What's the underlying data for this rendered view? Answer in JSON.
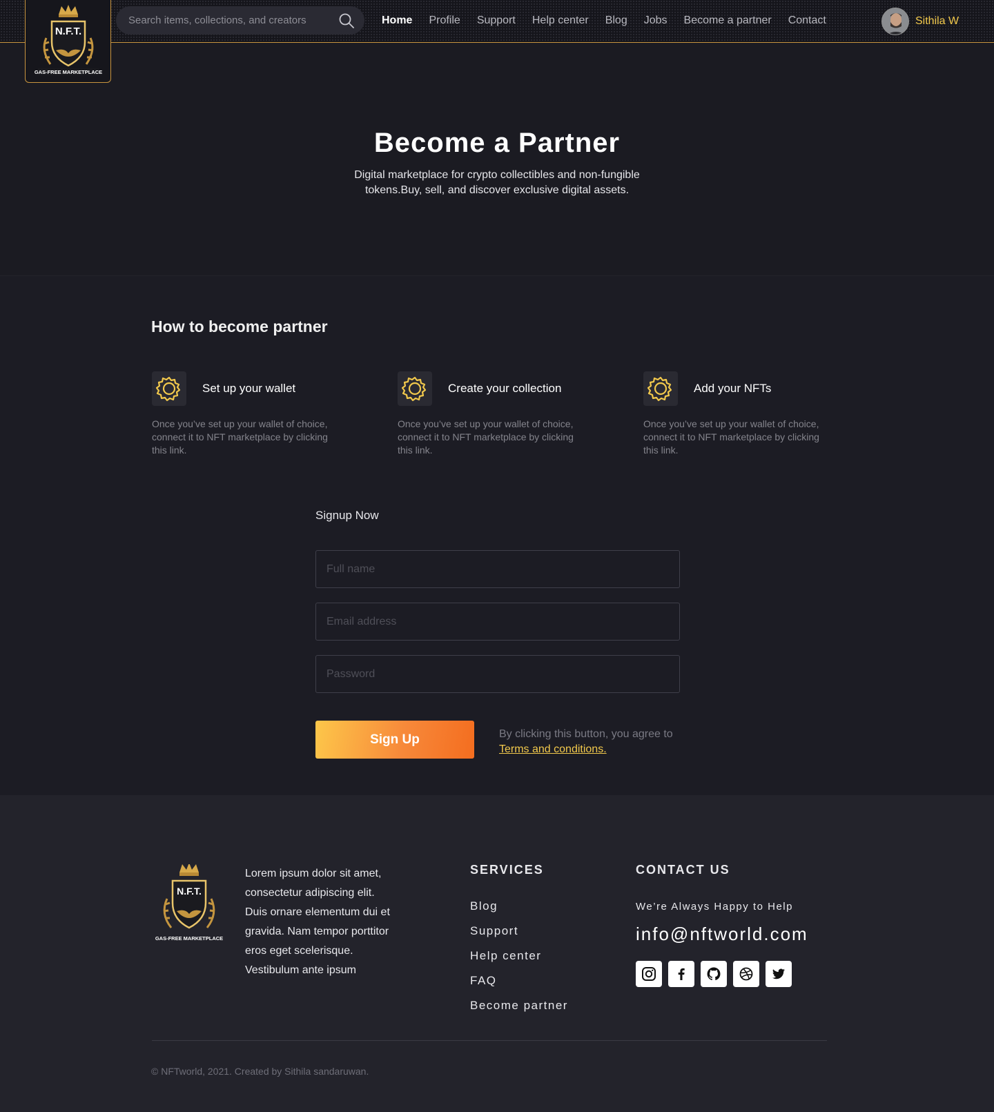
{
  "header": {
    "logo": {
      "brand": "N.F.T.",
      "tagline": "GAS-FREE MARKETPLACE"
    },
    "search": {
      "placeholder": "Search items, collections, and creators"
    },
    "nav": [
      {
        "label": "Home",
        "active": true
      },
      {
        "label": "Profile"
      },
      {
        "label": "Support"
      },
      {
        "label": "Help center"
      },
      {
        "label": "Blog"
      },
      {
        "label": "Jobs"
      },
      {
        "label": "Become a partner"
      },
      {
        "label": "Contact"
      }
    ],
    "user": {
      "name": "Sithila W"
    }
  },
  "hero": {
    "title": "Become a Partner",
    "subtitle": "Digital marketplace for crypto collectibles and non-fungible tokens.Buy, sell, and discover exclusive digital assets."
  },
  "how": {
    "title": "How to become partner",
    "steps": [
      {
        "icon": "gear-icon",
        "title": "Set up your wallet",
        "desc": "Once you’ve set up your wallet of choice, connect it to NFT marketplace by clicking this link."
      },
      {
        "icon": "gear-icon",
        "title": "Create your collection",
        "desc": "Once you’ve set up your wallet of choice, connect it to NFT marketplace by clicking this link."
      },
      {
        "icon": "gear-icon",
        "title": "Add your NFTs",
        "desc": "Once you’ve set up your wallet of choice, connect it to NFT marketplace by clicking this link."
      }
    ]
  },
  "signup": {
    "title": "Signup Now",
    "fullname_placeholder": "Full name",
    "email_placeholder": "Email address",
    "password_placeholder": "Password",
    "button": "Sign Up",
    "agree_text": "By clicking this button, you agree to",
    "terms_link": "Terms and conditions."
  },
  "footer": {
    "logo": {
      "brand": "N.F.T.",
      "tagline": "GAS-FREE MARKETPLACE"
    },
    "about": "Lorem ipsum dolor sit amet, consectetur adipiscing elit. Duis ornare elementum dui et gravida. Nam tempor porttitor eros eget scelerisque. Vestibulum ante ipsum",
    "services_title": "SERVICES",
    "services": [
      "Blog",
      "Support",
      "Help center",
      "FAQ",
      "Become partner"
    ],
    "contact_title": "CONTACT US",
    "tagline": "We’re Always Happy to Help",
    "email": "info@nftworld.com",
    "socials": [
      "instagram-icon",
      "facebook-icon",
      "github-icon",
      "dribbble-icon",
      "twitter-icon"
    ],
    "copyright": "© NFTworld, 2021. Created by Sithila sandaruwan."
  },
  "colors": {
    "accent": "#f2c94c",
    "brand_border": "#c9953f",
    "button_start": "#fdc74a",
    "button_end": "#f46d1f"
  }
}
